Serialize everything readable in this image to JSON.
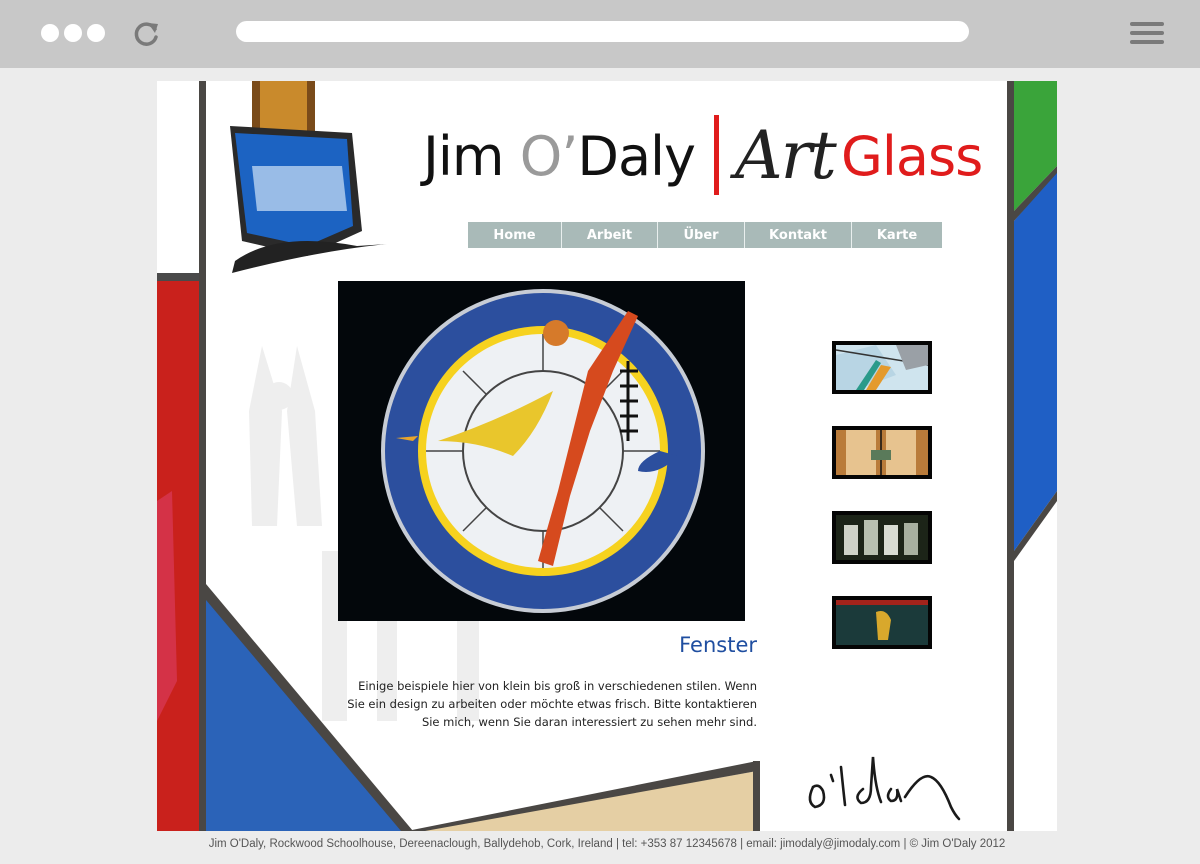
{
  "brand": {
    "name_part1": "Jim ",
    "name_part2": "O’",
    "name_part3": "Daly",
    "art": "Art",
    "glass": "Glass"
  },
  "nav": {
    "items": [
      {
        "label": "Home"
      },
      {
        "label": "Arbeit"
      },
      {
        "label": "Über"
      },
      {
        "label": "Kontakt"
      },
      {
        "label": "Karte"
      }
    ]
  },
  "section": {
    "title": "Fenster",
    "text": "Einige beispiele hier von klein bis groß in verschiedenen stilen. Wenn Sie ein design zu arbeiten oder möchte etwas frisch. Bitte kontaktieren Sie mich, wenn Sie daran interessiert zu sehen mehr sind."
  },
  "footer": {
    "text": "Jim O'Daly, Rockwood Schoolhouse, Dereenaclough, Ballydehob, Cork, Ireland  |  tel: +353 87 12345678  |  email: jimodaly@jimodaly.com  |  © Jim O'Daly 2012"
  },
  "colors": {
    "accent_red": "#e01c1c",
    "nav_bg": "#a9bab8",
    "title_blue": "#1f4ea0"
  }
}
